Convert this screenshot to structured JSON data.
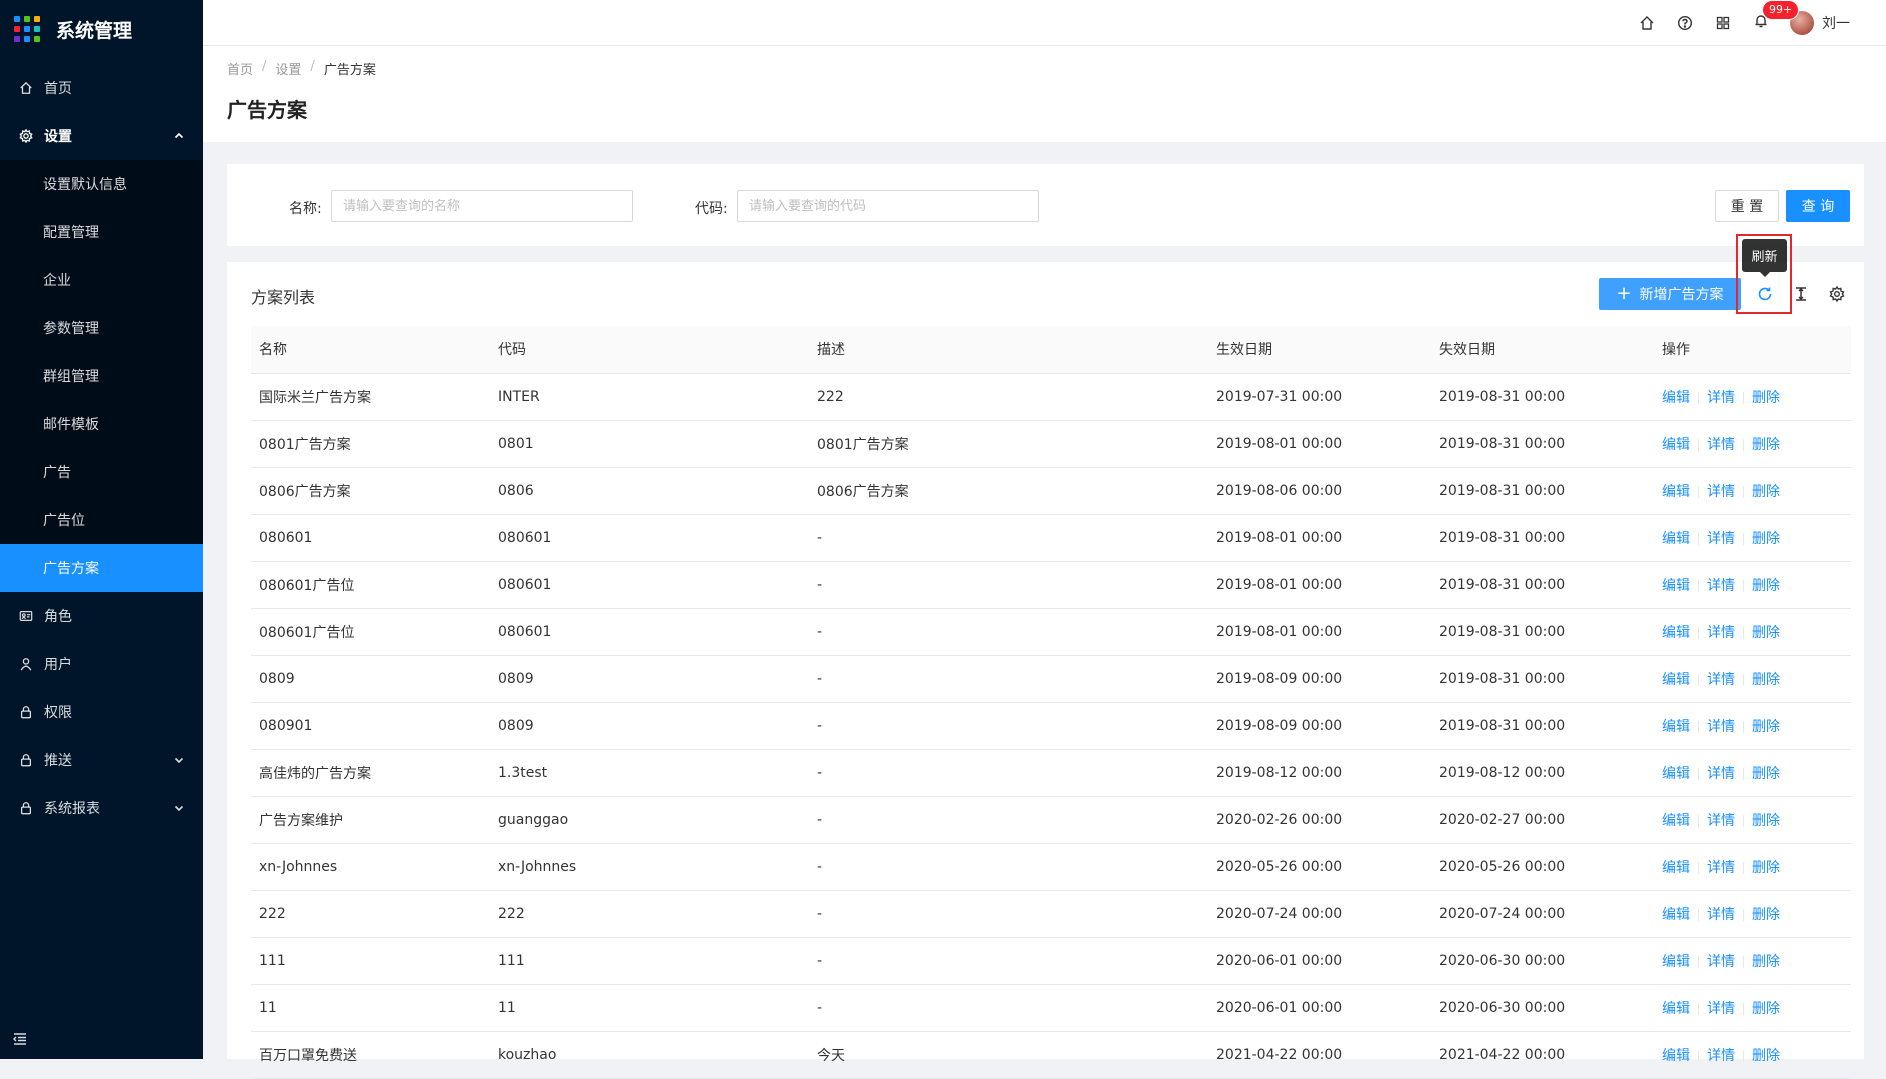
{
  "app": {
    "title": "系统管理",
    "logo_colors": [
      "#1890ff",
      "#52c41a",
      "#faad14",
      "#f5222d",
      "#1890ff",
      "#13c2c2",
      "#722ed1",
      "#1890ff",
      "#52c41a"
    ]
  },
  "sidebar": {
    "items": [
      {
        "label": "首页",
        "icon": "home-icon"
      },
      {
        "label": "设置",
        "icon": "gear-icon",
        "open": true
      }
    ],
    "settings_sub": [
      {
        "label": "设置默认信息"
      },
      {
        "label": "配置管理"
      },
      {
        "label": "企业"
      },
      {
        "label": "参数管理"
      },
      {
        "label": "群组管理"
      },
      {
        "label": "邮件模板"
      },
      {
        "label": "广告"
      },
      {
        "label": "广告位"
      },
      {
        "label": "广告方案",
        "active": true
      }
    ],
    "bottom_items": [
      {
        "label": "角色",
        "icon": "id-card-icon"
      },
      {
        "label": "用户",
        "icon": "user-icon"
      },
      {
        "label": "权限",
        "icon": "lock-icon"
      },
      {
        "label": "推送",
        "icon": "lock-icon",
        "expandable": true
      },
      {
        "label": "系统报表",
        "icon": "lock-icon",
        "expandable": true
      }
    ]
  },
  "header": {
    "badge": "99+",
    "user_name": "刘一"
  },
  "breadcrumb": [
    "首页",
    "设置",
    "广告方案"
  ],
  "page_title": "广告方案",
  "search": {
    "name_label": "名称:",
    "name_placeholder": "请输入要查询的名称",
    "code_label": "代码:",
    "code_placeholder": "请输入要查询的代码",
    "reset_label": "重 置",
    "query_label": "查 询"
  },
  "list": {
    "title": "方案列表",
    "add_label": "新增广告方案",
    "tooltip": "刷新",
    "columns": [
      "名称",
      "代码",
      "描述",
      "生效日期",
      "失效日期",
      "操作"
    ],
    "actions": [
      "编辑",
      "详情",
      "删除"
    ],
    "rows": [
      [
        "国际米兰广告方案",
        "INTER",
        "222",
        "2019-07-31 00:00",
        "2019-08-31 00:00"
      ],
      [
        "0801广告方案",
        "0801",
        "0801广告方案",
        "2019-08-01 00:00",
        "2019-08-31 00:00"
      ],
      [
        "0806广告方案",
        "0806",
        "0806广告方案",
        "2019-08-06 00:00",
        "2019-08-31 00:00"
      ],
      [
        "080601",
        "080601",
        "-",
        "2019-08-01 00:00",
        "2019-08-31 00:00"
      ],
      [
        "080601广告位",
        "080601",
        "-",
        "2019-08-01 00:00",
        "2019-08-31 00:00"
      ],
      [
        "080601广告位",
        "080601",
        "-",
        "2019-08-01 00:00",
        "2019-08-31 00:00"
      ],
      [
        "0809",
        "0809",
        "-",
        "2019-08-09 00:00",
        "2019-08-31 00:00"
      ],
      [
        "080901",
        "0809",
        "-",
        "2019-08-09 00:00",
        "2019-08-31 00:00"
      ],
      [
        "高佳炜的广告方案",
        "1.3test",
        "-",
        "2019-08-12 00:00",
        "2019-08-12 00:00"
      ],
      [
        "广告方案维护",
        "guanggao",
        "-",
        "2020-02-26 00:00",
        "2020-02-27 00:00"
      ],
      [
        "xn-Johnnes",
        "xn-Johnnes",
        "-",
        "2020-05-26 00:00",
        "2020-05-26 00:00"
      ],
      [
        "222",
        "222",
        "-",
        "2020-07-24 00:00",
        "2020-07-24 00:00"
      ],
      [
        "111",
        "111",
        "-",
        "2020-06-01 00:00",
        "2020-06-30 00:00"
      ],
      [
        "11",
        "11",
        "-",
        "2020-06-01 00:00",
        "2020-06-30 00:00"
      ],
      [
        "百万口罩免费送",
        "kouzhao",
        "今天",
        "2021-04-22 00:00",
        "2021-04-22 00:00"
      ]
    ]
  }
}
